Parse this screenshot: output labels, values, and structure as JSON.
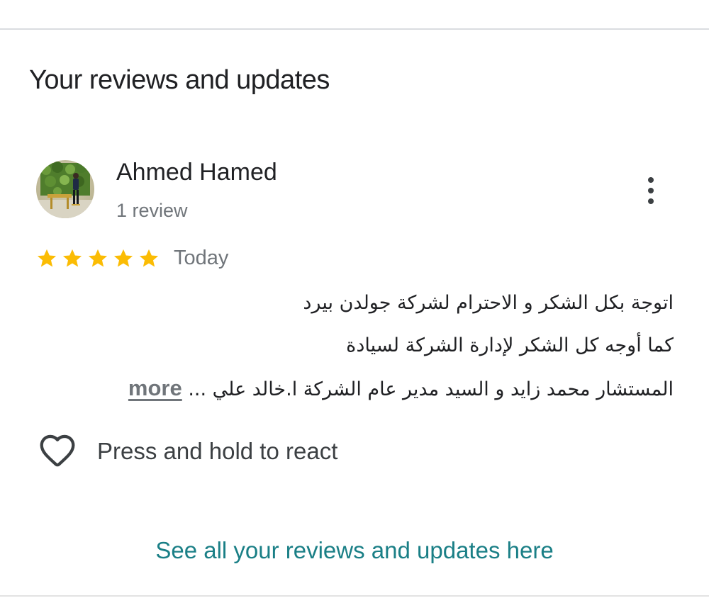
{
  "section": {
    "title": "Your reviews and updates"
  },
  "review": {
    "author_name": "Ahmed Hamed",
    "author_subtitle": "1 review",
    "rating": 5,
    "rating_max": 5,
    "date": "Today",
    "lines": [
      "اتوجة بكل الشكر و الاحترام لشركة جولدن بيرد",
      "كما أوجه كل الشكر لإدارة الشركة لسيادة",
      "المستشار محمد  زايد و السيد مدير عام الشركة ا.خالد علي ..."
    ],
    "more_label": "more",
    "react_label": "Press and hold to react",
    "menu_icon": "more-vert-icon",
    "react_icon": "heart-outline-icon"
  },
  "footer": {
    "see_all_label": "See all your reviews and updates here"
  },
  "colors": {
    "star": "#fbbc04",
    "link": "#1a7f86",
    "secondary_text": "#70757a",
    "divider": "#dadce0"
  }
}
